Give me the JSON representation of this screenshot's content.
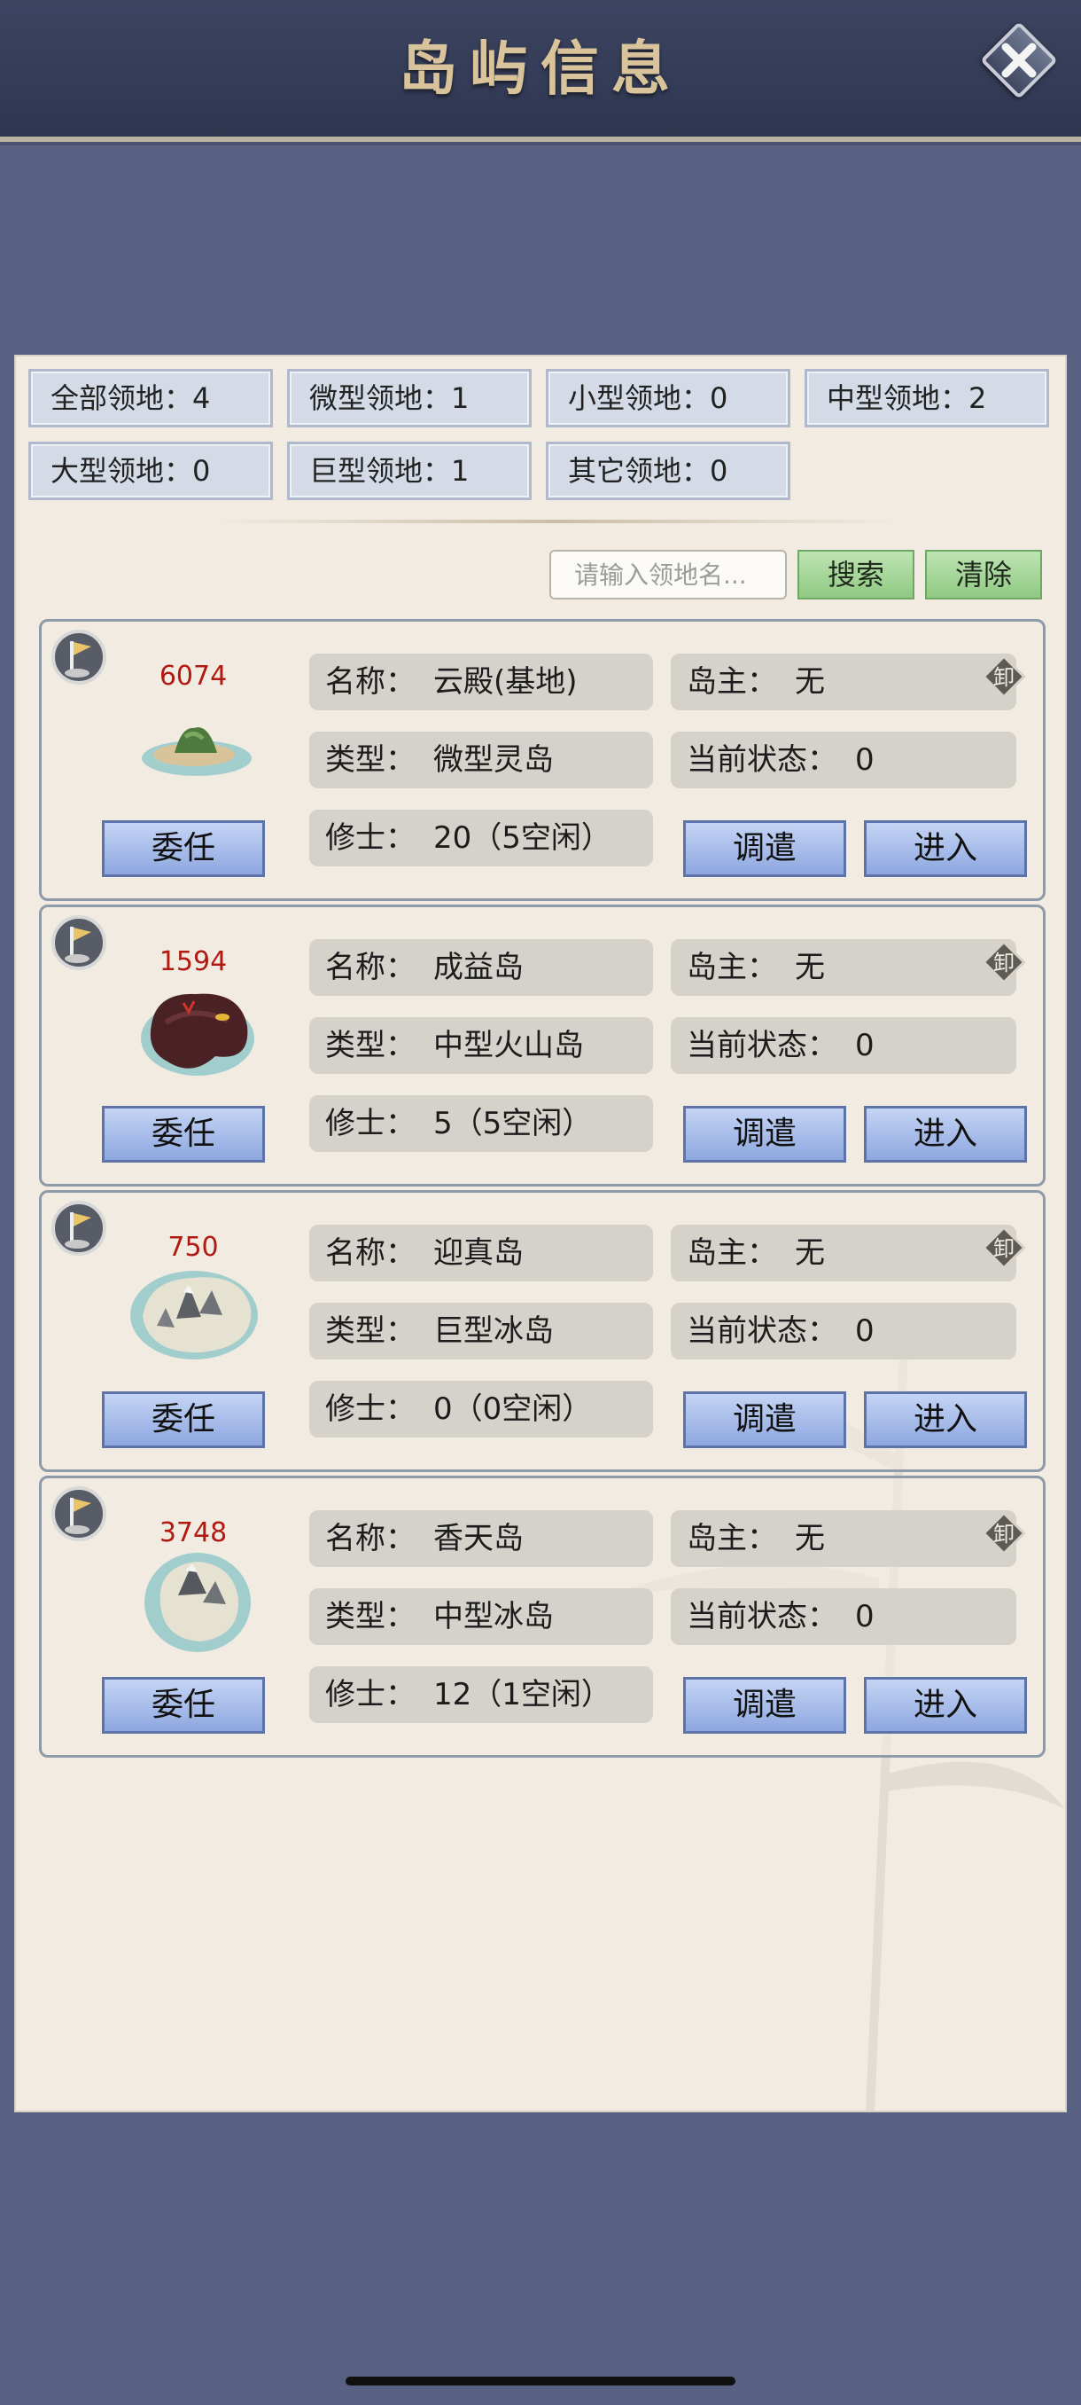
{
  "header": {
    "title": "岛屿信息"
  },
  "stats": [
    {
      "label": "全部领地",
      "sep": "：",
      "value": "4"
    },
    {
      "label": "微型领地",
      "sep": "：",
      "value": "1"
    },
    {
      "label": "小型领地",
      "sep": "：",
      "value": "0"
    },
    {
      "label": "中型领地",
      "sep": "：",
      "value": "2"
    },
    {
      "label": "大型领地",
      "sep": "：",
      "value": "0"
    },
    {
      "label": "巨型领地",
      "sep": "：",
      "value": "1"
    },
    {
      "label": "其它领地",
      "sep": "：",
      "value": "0"
    }
  ],
  "search": {
    "placeholder": "请输入领地名...",
    "search_label": "搜索",
    "clear_label": "清除"
  },
  "labels": {
    "name": "名称：",
    "type": "类型：",
    "cultivators": "修士：",
    "owner": "岛主：",
    "status": "当前状态：",
    "appoint": "委任",
    "dispatch": "调遣",
    "enter": "进入",
    "unload": "卸"
  },
  "islands": [
    {
      "power": "6074",
      "name": "云殿(基地)",
      "type": "微型灵岛",
      "cultivators": "20（5空闲）",
      "owner": "无",
      "status": "0"
    },
    {
      "power": "1594",
      "name": "成益岛",
      "type": "中型火山岛",
      "cultivators": "5（5空闲）",
      "owner": "无",
      "status": "0"
    },
    {
      "power": "750",
      "name": "迎真岛",
      "type": "巨型冰岛",
      "cultivators": "0（0空闲）",
      "owner": "无",
      "status": "0"
    },
    {
      "power": "3748",
      "name": "香天岛",
      "type": "中型冰岛",
      "cultivators": "12（1空闲）",
      "owner": "无",
      "status": "0"
    }
  ],
  "colors": {
    "background": "#586182",
    "panel": "#f1ebe1",
    "power_text": "#b11a12",
    "blue_button": "#a8bdec",
    "green_button": "#a9d89c"
  }
}
